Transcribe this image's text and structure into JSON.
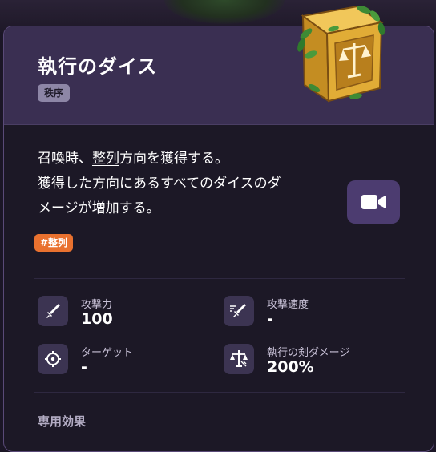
{
  "card": {
    "title": "執行のダイス",
    "tag": "秩序",
    "description": {
      "line1_prefix": "召喚時、",
      "line1_underlined": "整列",
      "line1_suffix": "方向を獲得する。",
      "line2": "獲得した方向にあるすべてのダイスのダ",
      "line3": "メージが増加する。"
    },
    "keyword_tag": "#整列"
  },
  "stats": [
    {
      "label": "攻撃力",
      "value": "100",
      "icon": "sword-icon"
    },
    {
      "label": "攻撃速度",
      "value": "-",
      "icon": "attack-speed-icon"
    },
    {
      "label": "ターゲット",
      "value": "-",
      "icon": "target-icon"
    },
    {
      "label": "執行の剣ダメージ",
      "value": "200%",
      "icon": "scales-sword-icon"
    }
  ],
  "section": {
    "title": "専用効果"
  },
  "colors": {
    "header_bg": "#3a2f52",
    "card_bg": "#1c1826",
    "order_tag": "#8d86a6",
    "keyword_tag": "#e9712f",
    "video_button": "#4c3c70",
    "dice_gold": "#d9a62e"
  }
}
